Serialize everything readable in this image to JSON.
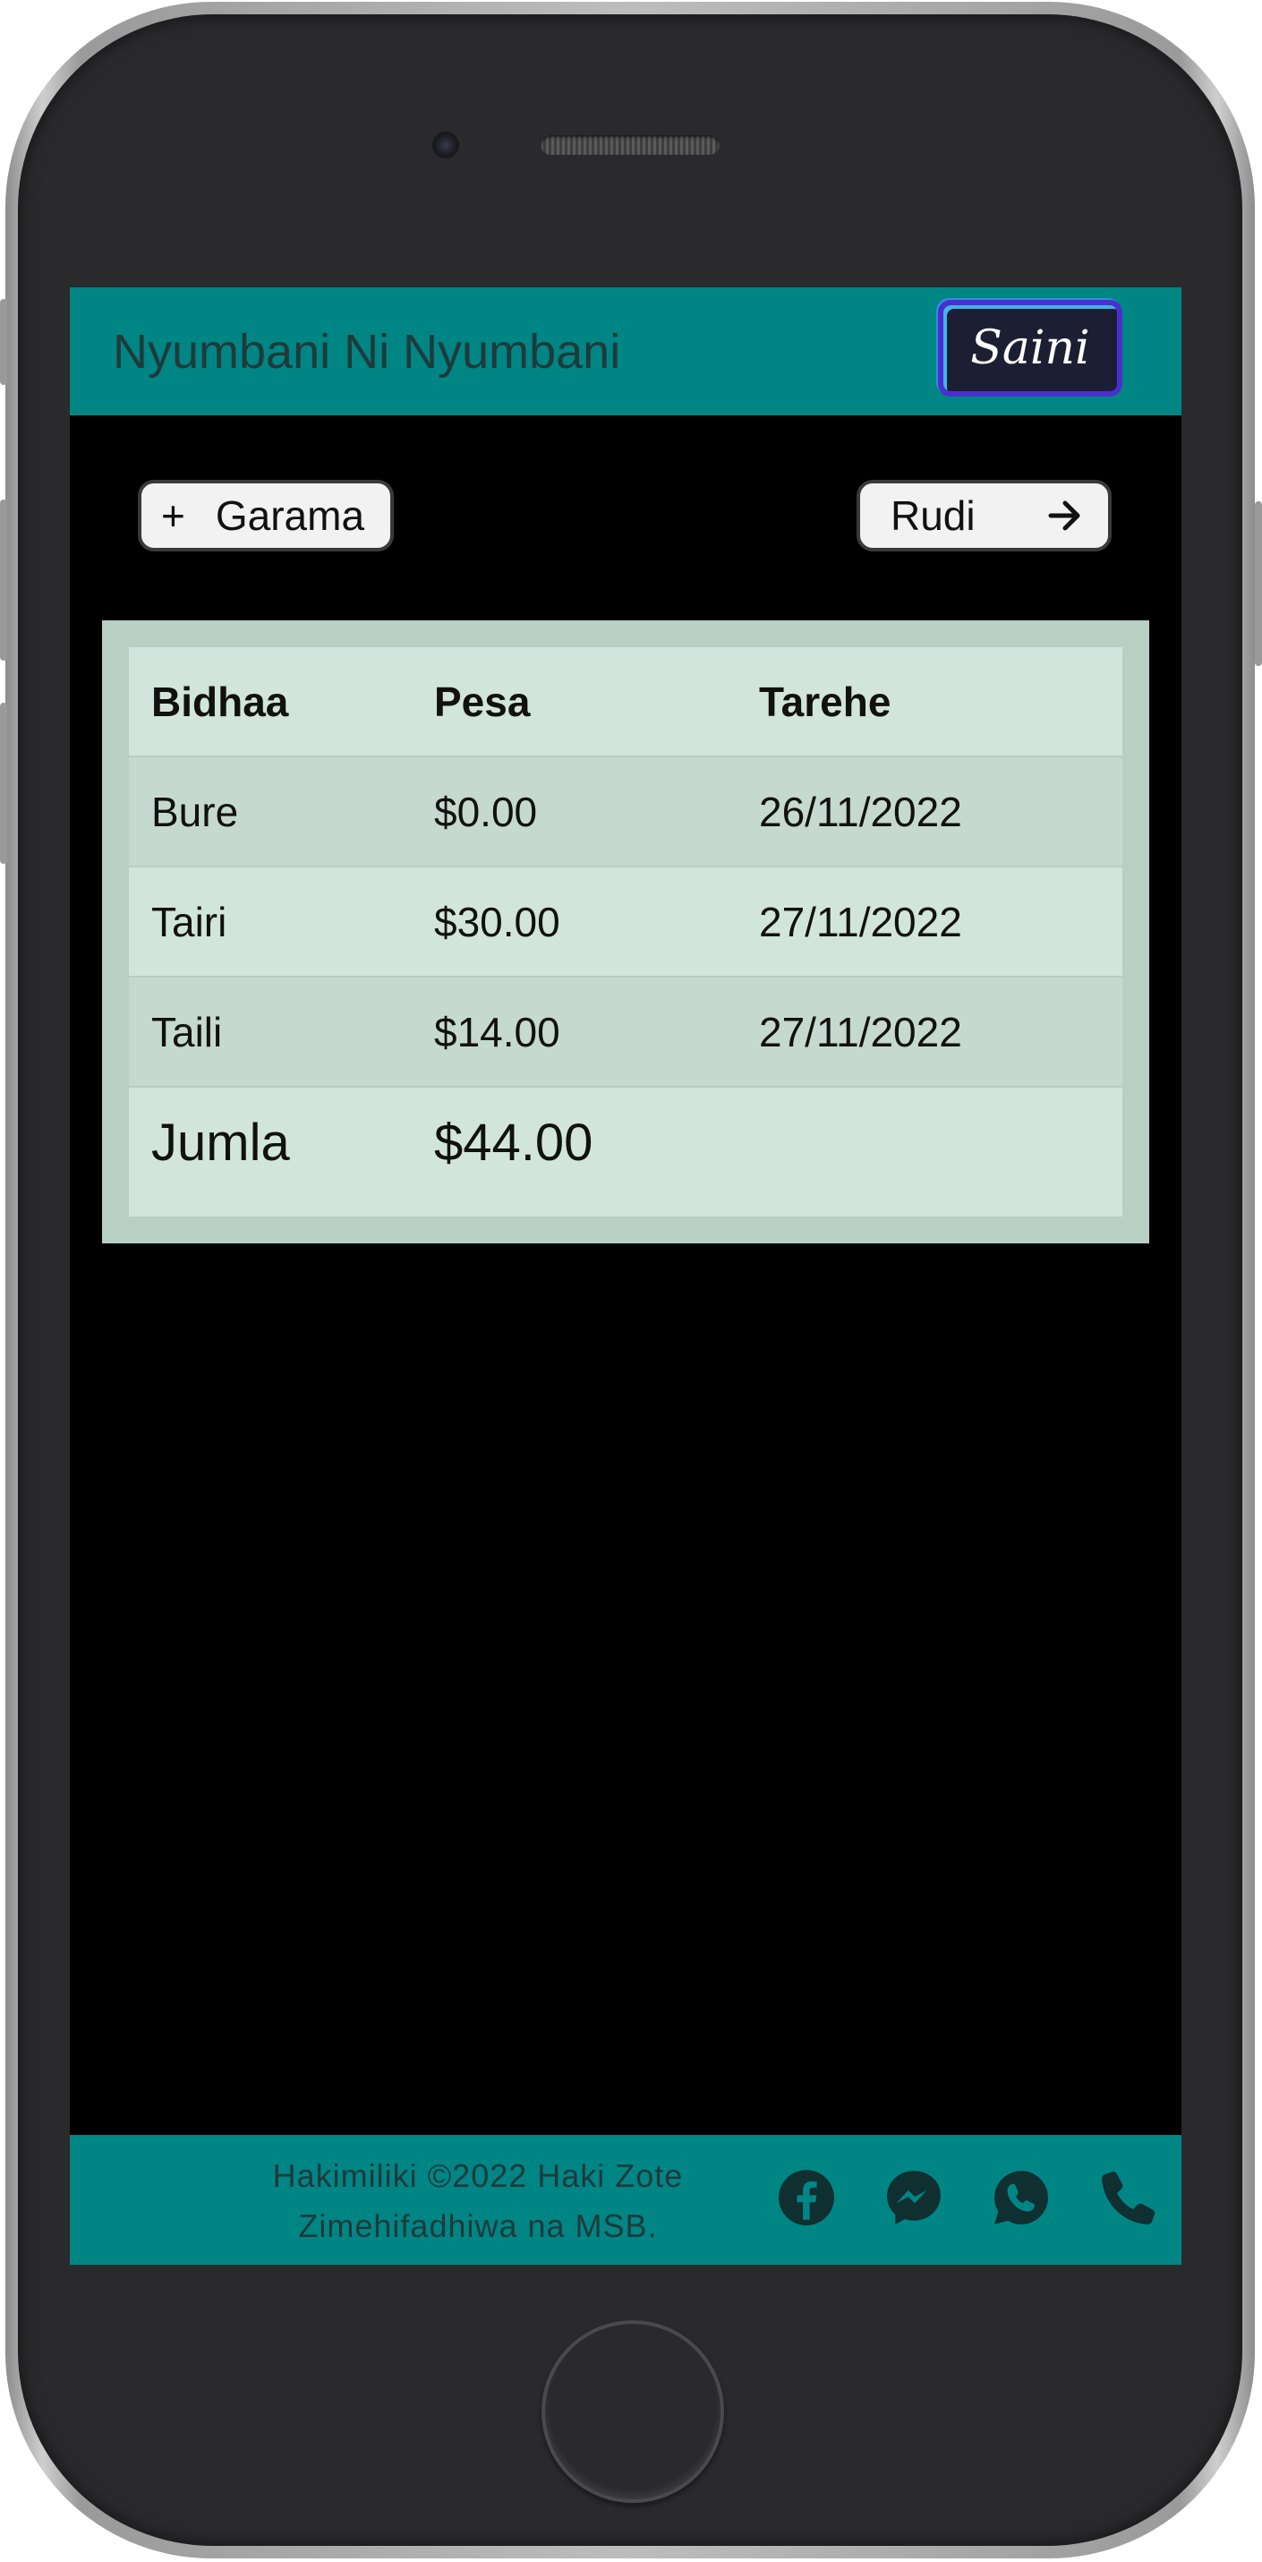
{
  "app": {
    "title": "Nyumbani Ni Nyumbani",
    "signin_label": "Saini"
  },
  "actions": {
    "add_label": "Garama",
    "back_label": "Rudi"
  },
  "table": {
    "headers": [
      "Bidhaa",
      "Pesa",
      "Tarehe"
    ],
    "rows": [
      [
        "Bure",
        "$0.00",
        "26/11/2022"
      ],
      [
        "Tairi",
        "$30.00",
        "27/11/2022"
      ],
      [
        "Taili",
        "$14.00",
        "27/11/2022"
      ]
    ],
    "total_label": "Jumla",
    "total_value": "$44.00"
  },
  "footer": {
    "copyright_line1": "Hakimiliki ©2022 Haki Zote",
    "copyright_line2": "Zimehifadhiwa na MSB.",
    "icons": [
      "facebook-icon",
      "messenger-icon",
      "whatsapp-icon",
      "phone-icon"
    ]
  },
  "colors": {
    "header_bg": "#008585",
    "screen_bg": "#000000",
    "table_bg": "#d2e5dc",
    "signin_bg": "#1c1f33"
  }
}
